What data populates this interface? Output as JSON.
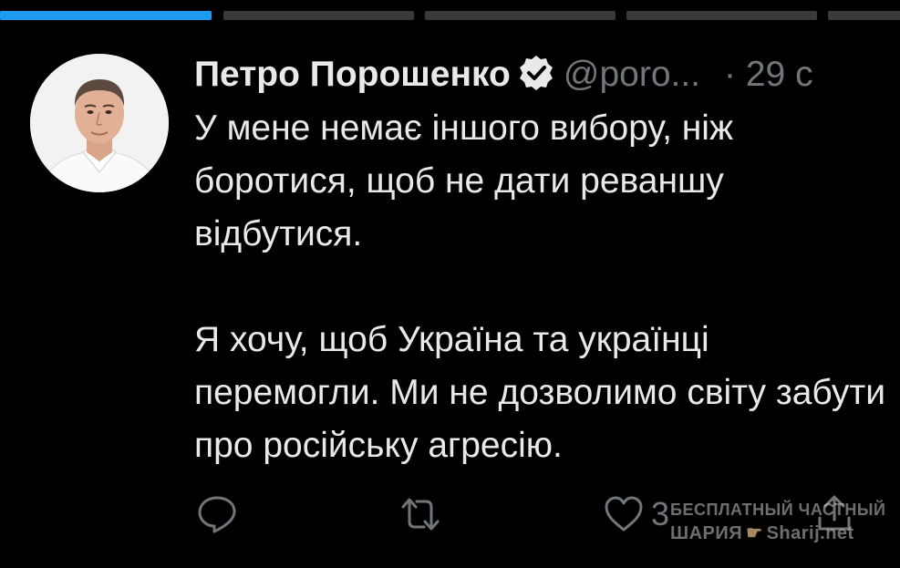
{
  "story": {
    "segments": [
      {
        "progress": 1.0
      },
      {
        "progress": 0.0
      },
      {
        "progress": 0.0
      },
      {
        "progress": 0.0
      },
      {
        "progress": 0.0
      }
    ]
  },
  "tweet": {
    "author_name": "Петро Порошенко",
    "handle": "@poro...",
    "time": "· 29 с",
    "paragraphs": [
      "У мене немає іншого вибору, ніж боротися, щоб не дати реваншу відбутися.",
      "Я хочу, щоб Україна та українці перемогли. Ми не дозволимо світу забути про російську агресію."
    ],
    "actions": {
      "reply_icon": "reply-icon",
      "retweet_icon": "retweet-icon",
      "like_icon": "heart-icon",
      "like_count": "3",
      "share_icon": "share-icon"
    }
  },
  "watermark": {
    "line1": "БЕСПЛАТНЫЙ ЧАСТНЫЙ",
    "line2_left": "ШАРИЯ",
    "line2_right": "Sharij.net"
  },
  "colors": {
    "background": "#000000",
    "text": "#e7e9ea",
    "muted": "#71767b",
    "accent": "#1d9bf0"
  }
}
